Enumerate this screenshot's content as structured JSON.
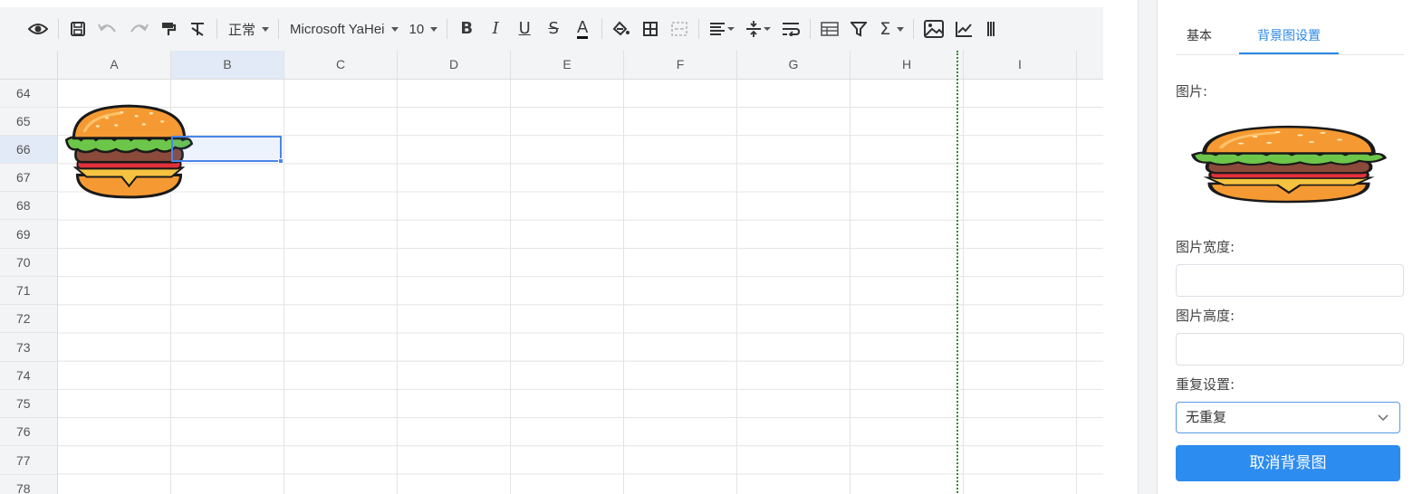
{
  "toolbar": {
    "style_select": "正常",
    "font_family": "Microsoft YaHei",
    "font_size": "10",
    "bold_glyph": "B",
    "italic_glyph": "I",
    "underline_glyph": "U",
    "strike_glyph": "S",
    "color_glyph": "A",
    "sum_glyph": "Σ",
    "icons": [
      "eye-icon",
      "save-icon",
      "undo-icon",
      "redo-icon",
      "format-painter-icon",
      "clear-format-icon",
      "bold-icon",
      "italic-icon",
      "underline-icon",
      "strikethrough-icon",
      "font-color-icon",
      "fill-color-icon",
      "border-icon",
      "merge-cells-icon",
      "align-icon",
      "valign-icon",
      "wrap-text-icon",
      "freeze-icon",
      "filter-icon",
      "sum-icon",
      "image-icon",
      "chart-icon"
    ]
  },
  "sheet": {
    "columns": [
      "A",
      "B",
      "C",
      "D",
      "E",
      "F",
      "G",
      "H",
      "I"
    ],
    "rows": [
      "64",
      "65",
      "66",
      "67",
      "68",
      "69",
      "70",
      "71",
      "72",
      "73",
      "74",
      "75",
      "76",
      "77",
      "78"
    ],
    "selected_column": "B",
    "selected_row": "66"
  },
  "panel": {
    "tabs": {
      "basic": "基本",
      "background": "背景图设置"
    },
    "image_label": "图片:",
    "width_label": "图片宽度:",
    "width_value": "",
    "height_label": "图片高度:",
    "height_value": "",
    "repeat_label": "重复设置:",
    "repeat_value": "无重复",
    "cancel_button": "取消背景图"
  },
  "colors": {
    "accent": "#2d8cf0",
    "selection": "#4a86e8",
    "page_break": "#2e8b2e"
  }
}
